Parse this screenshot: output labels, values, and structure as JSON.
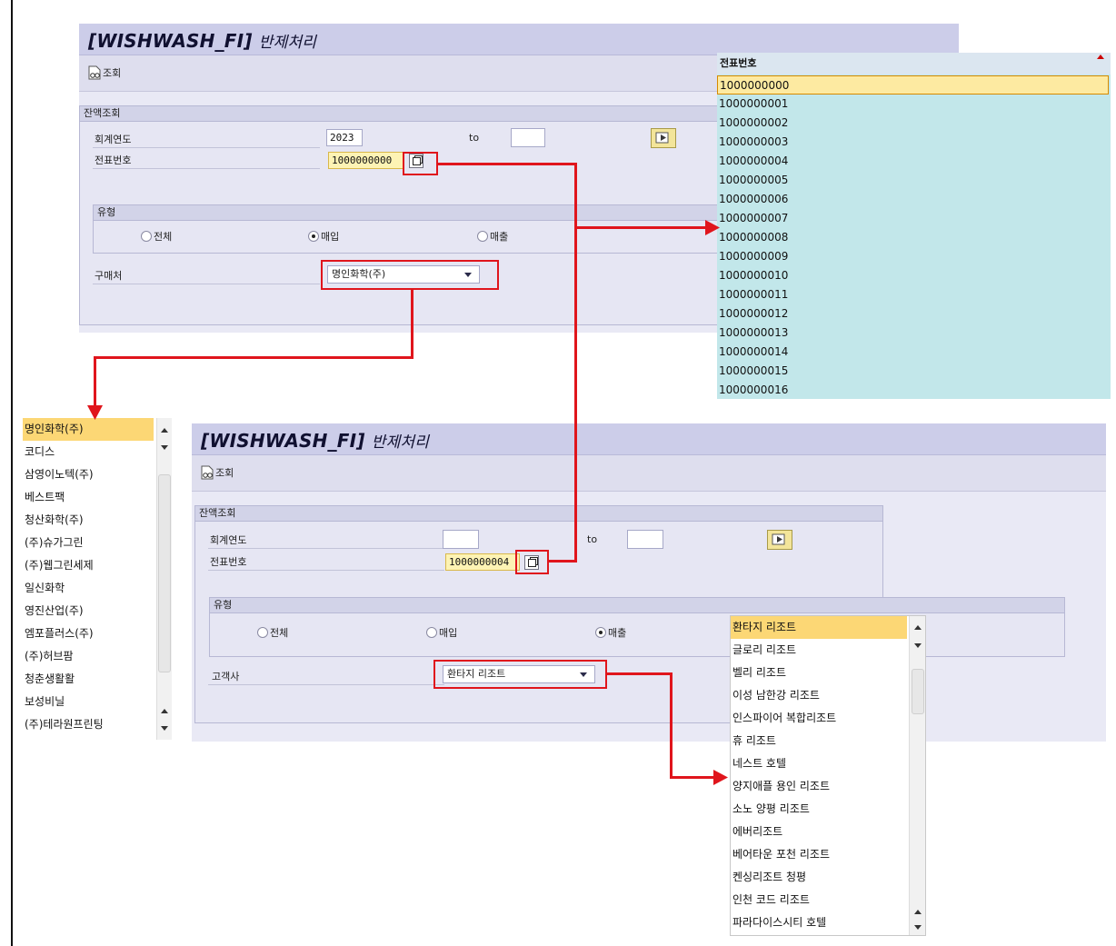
{
  "app": {
    "title_code": "[WISHWASH_FI]",
    "title_text": "반제처리",
    "toolbar_query": "조회"
  },
  "upper": {
    "group_title": "잔액조회",
    "fiscal_year_label": "회계연도",
    "fiscal_year_value": "2023",
    "to_label": "to",
    "voucher_label": "전표번호",
    "voucher_value": "1000000000",
    "type_group_title": "유형",
    "radio_all": "전체",
    "radio_purchase": "매입",
    "radio_sales": "매출",
    "selected_radio": "매입",
    "vendor_label": "구매처",
    "vendor_value": "명인화학(주)"
  },
  "lower": {
    "group_title": "잔액조회",
    "fiscal_year_label": "회계연도",
    "fiscal_year_value": "",
    "to_label": "to",
    "voucher_label": "전표번호",
    "voucher_value": "1000000004",
    "type_group_title": "유형",
    "radio_all": "전체",
    "radio_purchase": "매입",
    "radio_sales": "매출",
    "selected_radio": "매출",
    "customer_label": "고객사",
    "customer_value": "환타지 리조트"
  },
  "voucher_popup": {
    "header": "전표번호",
    "items": [
      "1000000000",
      "1000000001",
      "1000000002",
      "1000000003",
      "1000000004",
      "1000000005",
      "1000000006",
      "1000000007",
      "1000000008",
      "1000000009",
      "1000000010",
      "1000000011",
      "1000000012",
      "1000000013",
      "1000000014",
      "1000000015",
      "1000000016"
    ],
    "selected": "1000000000"
  },
  "vendor_dropdown": {
    "items": [
      "명인화학(주)",
      "코디스",
      "삼영이노텍(주)",
      "베스트팩",
      "청산화학(주)",
      "(주)슈가그린",
      "(주)웹그린세제",
      "일신화학",
      "영진산업(주)",
      "엠포플러스(주)",
      "(주)허브팜",
      "청춘생활활",
      "보성비닐",
      "(주)테라원프린팅"
    ],
    "selected": "명인화학(주)"
  },
  "customer_dropdown": {
    "items": [
      "환타지 리조트",
      "글로리 리조트",
      "벨리 리조트",
      "이성 남한강 리조트",
      "인스파이어 복합리조트",
      "휴 리조트",
      "네스트 호텔",
      "양지애플 용인 리조트",
      "소노 양평 리조트",
      "에버리조트",
      "베어타운 포천 리조트",
      "켄싱리조트 청평",
      "인천 코드 리조트",
      "파라다이스시티 호텔"
    ],
    "selected": "환타지 리조트"
  },
  "colors": {
    "annotation_red": "#e0151c",
    "selection_yellow": "#fcd775",
    "popup_cyan": "#c2e7ea",
    "window_bg": "#e9e9f5"
  }
}
